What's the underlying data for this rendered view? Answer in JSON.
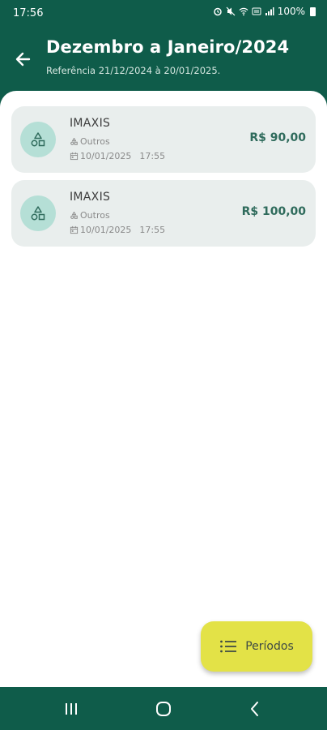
{
  "status_bar": {
    "time": "17:56",
    "battery": "100%",
    "icons": [
      "alarm-icon",
      "mute-icon",
      "wifi-icon",
      "data-icon",
      "signal-icon",
      "battery-icon"
    ]
  },
  "header": {
    "title": "Dezembro a Janeiro/2024",
    "subtitle": "Referência 21/12/2024 à 20/01/2025."
  },
  "transactions": [
    {
      "name": "IMAXIS",
      "category": "Outros",
      "date": "10/01/2025",
      "time": "17:55",
      "amount": "R$ 90,00"
    },
    {
      "name": "IMAXIS",
      "category": "Outros",
      "date": "10/01/2025",
      "time": "17:55",
      "amount": "R$ 100,00"
    }
  ],
  "fab": {
    "label": "Períodos"
  },
  "colors": {
    "primary": "#0f5c4a",
    "accent": "#e3e247",
    "card": "#e9eeed",
    "avatar": "#b5dfd6"
  }
}
